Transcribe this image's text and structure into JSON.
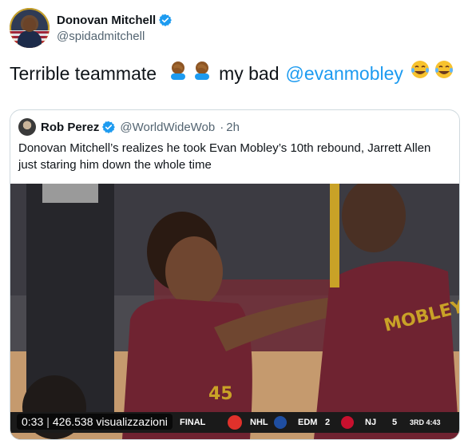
{
  "author": {
    "name": "Donovan Mitchell",
    "handle": "@spidadmitchell",
    "verified": true
  },
  "tweet": {
    "text_before": "Terrible teammate",
    "emoji_facepalm": "face-palm-emoji",
    "text_middle": "my bad",
    "mention": "@evanmobley",
    "emoji_joy": "joy-emoji"
  },
  "quoted": {
    "name": "Rob Perez",
    "handle": "@WorldWideWob",
    "separator": "·",
    "time": "2h",
    "text": "Donovan Mitchell’s realizes he took Evan Mobley’s 10th rebound, Jarrett Allen just staring him down the whole time"
  },
  "video": {
    "time": "0:33",
    "views": "426.538 visualizzazioni",
    "jersey_name": "MOBLEY",
    "jersey_number": "45"
  },
  "scoreboard": {
    "status": "FINAL",
    "league": "NHL",
    "team1": "EDM",
    "score1": "2",
    "team2": "NJ",
    "score2": "5",
    "period": "3RD 4:43"
  },
  "colors": {
    "link": "#1d9bf0",
    "verified": "#1d9bf0",
    "wine": "#6f2331"
  }
}
